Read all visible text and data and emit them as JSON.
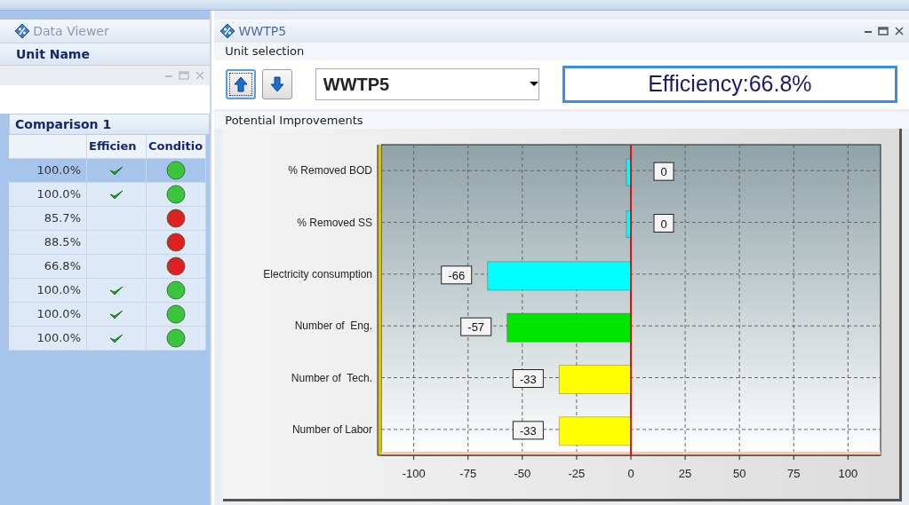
{
  "data_viewer": {
    "title": "Data Viewer",
    "column_header": "Unit Name",
    "comparison": {
      "title": "Comparison 1",
      "columns": [
        "Efficien",
        "Conditio"
      ],
      "rows": [
        {
          "value": "100.0%",
          "checked": true,
          "color": "#3cc43c",
          "selected": true
        },
        {
          "value": "100.0%",
          "checked": true,
          "color": "#3cc43c",
          "selected": false
        },
        {
          "value": "85.7%",
          "checked": false,
          "color": "#e02020",
          "selected": false
        },
        {
          "value": "88.5%",
          "checked": false,
          "color": "#e02020",
          "selected": false
        },
        {
          "value": "66.8%",
          "checked": false,
          "color": "#e02020",
          "selected": false
        },
        {
          "value": "100.0%",
          "checked": true,
          "color": "#3cc43c",
          "selected": false
        },
        {
          "value": "100.0%",
          "checked": true,
          "color": "#3cc43c",
          "selected": false
        },
        {
          "value": "100.0%",
          "checked": true,
          "color": "#3cc43c",
          "selected": false
        }
      ]
    }
  },
  "unit_window": {
    "title": "WWTP5",
    "unit_selection": {
      "label": "Unit selection",
      "unit": "WWTP5",
      "efficiency": "Efficiency:66.8%"
    },
    "potential_improvements": {
      "label": "Potential Improvements",
      "chart_data": {
        "type": "bar",
        "orientation": "horizontal",
        "stacked": true,
        "data_labels": true,
        "categories": [
          "% Removed BOD",
          "% Removed SS",
          "Electricity consumption",
          "Number of  Eng.",
          "Number of  Tech.",
          "Number of Labor"
        ],
        "series": [
          {
            "color": "#00ffff",
            "values": [
              0,
              0,
              -66,
              null,
              null,
              null
            ]
          },
          {
            "color": "#00e600",
            "values": [
              null,
              null,
              null,
              -57,
              null,
              null
            ]
          },
          {
            "color": "#ffff00",
            "values": [
              null,
              null,
              null,
              null,
              -33,
              -33
            ]
          }
        ],
        "grid": true,
        "ref_lines": [
          {
            "axis": "x",
            "value": 0,
            "color": "#e01010"
          }
        ],
        "xlim": [
          -115,
          115
        ],
        "xticks": [
          -100,
          -75,
          -50,
          -25,
          0,
          25,
          50,
          75,
          100
        ]
      }
    }
  }
}
